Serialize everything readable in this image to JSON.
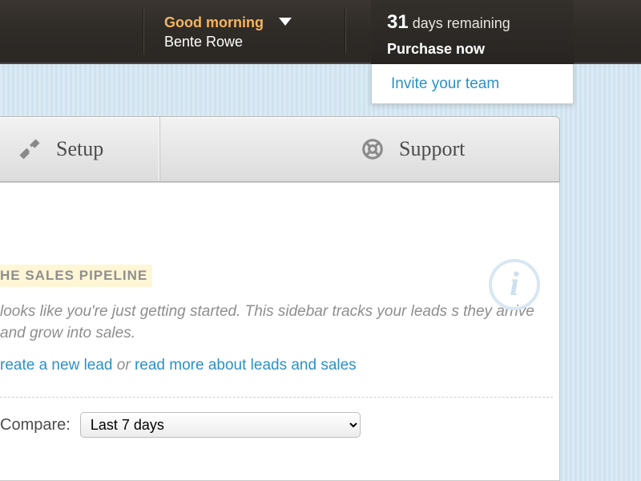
{
  "topbar": {
    "greeting": "Good morning",
    "user_name": "Bente Rowe",
    "trial": {
      "days": "31",
      "remaining_label": "days remaining",
      "purchase_label": "Purchase now"
    },
    "invite_label": "Invite your team"
  },
  "toolbar": {
    "setup_label": "Setup",
    "support_label": "Support"
  },
  "panel": {
    "heading": "HE SALES PIPELINE",
    "description": " looks like you're just getting started. This sidebar tracks your leads s they arrive and grow into sales.",
    "link_create": "reate a new lead",
    "link_or": " or ",
    "link_readmore": "read more about leads and sales",
    "compare_label": "Compare:",
    "compare_options": [
      "Last 7 days"
    ],
    "compare_selected": "Last 7 days"
  }
}
